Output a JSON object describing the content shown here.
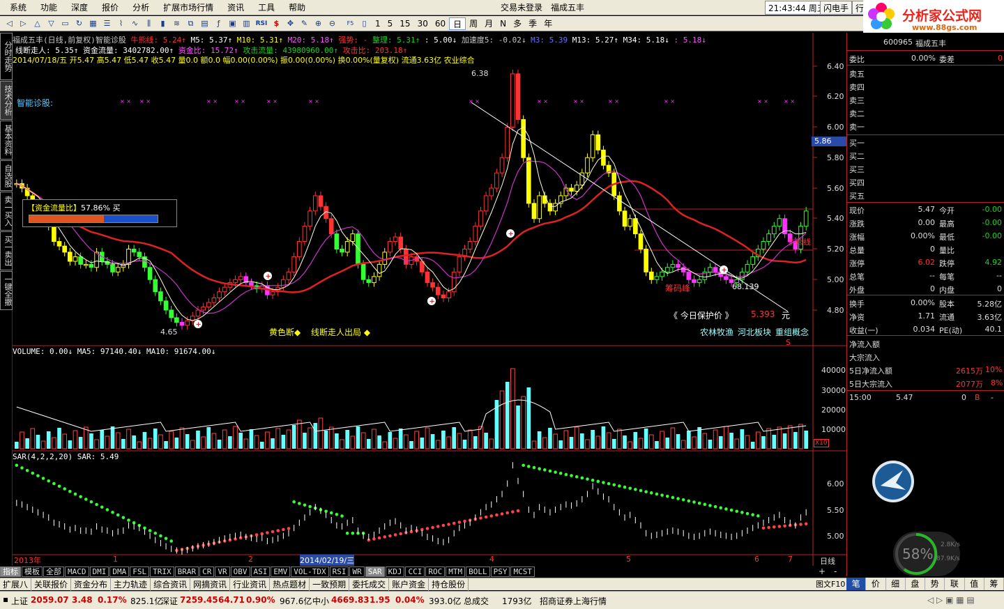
{
  "menu": {
    "items": [
      "系统",
      "功能",
      "深度",
      "报价",
      "分析",
      "扩展市场行情",
      "资讯",
      "工具",
      "帮助"
    ],
    "login_status": "交易未登录",
    "stock_name": "福成五丰",
    "clock": "21:43:44 周五",
    "btn1": "闪电手",
    "btn2": "行"
  },
  "toolbar": {
    "periods": [
      "1",
      "5",
      "15",
      "30",
      "60",
      "日",
      "周",
      "月",
      "N",
      "多",
      "季",
      "年"
    ],
    "active_period": "日",
    "rsi": "RSI"
  },
  "logo": {
    "title": "分析家公式网",
    "url": "www.88gs.com"
  },
  "left_tabs": [
    "分时走势",
    "技术分析",
    "基本资料",
    "自选股",
    "卖一买入",
    "买一卖出",
    "一键全撤"
  ],
  "chart": {
    "header1": {
      "name": "福成五丰(日线,前复权)智能诊股",
      "niu_label": "牛熊线: 5.24↑",
      "ma5": "M5: 5.37↑",
      "ma10": "M10: 5.31↑",
      "ma20": "M20: 5.18↑",
      "qiangshi": "强势: -",
      "zhengli": "整理: 5.31↑",
      "v1": ": 5.00↓",
      "accel": "加速度5: -0.02↓",
      "m3": "M3: 5.39",
      "m13": "M13: 5.27↑",
      "m34": "M34: 5.18↓",
      "v2": ": 5.18↓"
    },
    "header2": {
      "xdzr": "线断走人: 5.35↑",
      "zjll": "资金流量: 3402782.00↑",
      "zjb": "资金比: 15.72↑",
      "gjll": "攻击流量: 43980960.00↑",
      "gjb": "攻击比: 203.18↑"
    },
    "header3": "2014/07/18/五 开5.47 高5.47 低5.47 收5.47 量0.0 额0.0 幅0.00(0.00%) 振0.00(0.00%) 换0.00%(量复权) 流通3.63亿 农业综合",
    "zhineng": "智能诊股:",
    "fund_box": {
      "label": "【资金流量比】",
      "value": "57.86%",
      "suffix": "买",
      "buy_ratio": 0.58
    },
    "ann": {
      "high": "6.38",
      "low": "4.65",
      "niu": "牛熊线",
      "chouma": "筹码峰",
      "v68": "68.139",
      "protect_label": "《 今日保护价 》",
      "protect_val": "5.393",
      "yuan": "元",
      "huangse": "黄色断",
      "xduan": "线断走人出局",
      "tag1": "农林牧渔",
      "tag2": "河北板块",
      "tag3": "重组概念",
      "s": "S"
    },
    "price_axis": [
      "6.40",
      "6.20",
      "6.00",
      "5.80",
      "5.60",
      "5.40",
      "5.20",
      "5.00",
      "4.80"
    ],
    "current_price": "5.86",
    "volume_header": "VOLUME: 0.00↓ MA5: 97140.40↓ MA10: 91674.00↓",
    "volume_axis": [
      "40000",
      "30000",
      "20000",
      "10000"
    ],
    "vol_unit": "X10",
    "sar_header": "SAR(4,2,2,20) SAR: 5.49",
    "sar_axis": [
      "6.00",
      "5.50",
      "5.00"
    ],
    "date_axis": [
      {
        "t": "2013年"
      },
      {
        "t": "1"
      },
      {
        "t": "2"
      },
      {
        "t": "2014/02/19/三"
      },
      {
        "t": "4"
      },
      {
        "t": "5"
      },
      {
        "t": "6"
      },
      {
        "t": "7"
      }
    ],
    "period_label": "日线"
  },
  "bottom_tabs": [
    "指标",
    "模板",
    "全部",
    "MACD",
    "DMI",
    "DMA",
    "FSL",
    "TRIX",
    "BRAR",
    "CR",
    "VR",
    "OBV",
    "ASI",
    "EMV",
    "VOL-TDX",
    "RSI",
    "WR",
    "SAR",
    "KDJ",
    "CCI",
    "ROC",
    "MTM",
    "BOLL",
    "PSY",
    "MCST"
  ],
  "bottom_active": "指标",
  "bottom_right": {
    "plus": "+",
    "minus": "-"
  },
  "nav_tabs": [
    "扩展八",
    "关联报价",
    "资金分布",
    "主力轨迹",
    "综合资讯",
    "网摘资讯",
    "行业资讯",
    "热点题材",
    "一致预期",
    "委托成交",
    "账户资金",
    "持仓股份"
  ],
  "chart_label": "图文F10",
  "right_tabs": [
    "笔",
    "价",
    "细",
    "盘",
    "势",
    "联",
    "值",
    "筹"
  ],
  "right_active": "笔",
  "quote": {
    "code": "600965",
    "name": "福成五丰",
    "weibi_l": "委比",
    "weibi_v": "0.00%",
    "weicha_l": "委差",
    "weicha_v": "0",
    "sell": [
      "卖五",
      "卖四",
      "卖三",
      "卖二",
      "卖一"
    ],
    "buy": [
      "买一",
      "买二",
      "买三",
      "买四",
      "买五"
    ],
    "rows": [
      {
        "l1": "现价",
        "v1": "5.47",
        "l2": "今开",
        "v2": "-0.00"
      },
      {
        "l1": "涨跌",
        "v1": "0.00",
        "l2": "最高",
        "v2": "-0.00"
      },
      {
        "l1": "涨幅",
        "v1": "0.00%",
        "l2": "最低",
        "v2": "-0.00"
      },
      {
        "l1": "总量",
        "v1": "0",
        "l2": "量比",
        "v2": ""
      },
      {
        "l1": "涨停",
        "v1": "6.02",
        "l2": "跌停",
        "v2": "4.92"
      },
      {
        "l1": "总笔",
        "v1": "--",
        "l2": "每笔",
        "v2": "--"
      },
      {
        "l1": "外盘",
        "v1": "0",
        "l2": "内盘",
        "v2": "0"
      }
    ],
    "rows2": [
      {
        "l1": "换手",
        "v1": "0.00%",
        "l2": "股本",
        "v2": "5.28亿"
      },
      {
        "l1": "净资",
        "v1": "1.71",
        "l2": "流通",
        "v2": "3.63亿"
      },
      {
        "l1": "收益(一)",
        "v1": "0.034",
        "l2": "PE(动)",
        "v2": "40.1"
      }
    ],
    "flow": [
      "净流入额",
      "大宗流入"
    ],
    "flow5": [
      {
        "l": "5日净流入额",
        "v": "2615万",
        "p": "10%"
      },
      {
        "l": "5日大宗流入",
        "v": "2077万",
        "p": "8%"
      }
    ],
    "tick": {
      "time": "15:00",
      "price": "5.47",
      "vol": "0",
      "bs": "B",
      "x": "-"
    },
    "gauge": {
      "pct": "58%",
      "up": "2.8K/s",
      "down": "87.9K/s"
    }
  },
  "status": {
    "sh_l": "上证",
    "sh_v": "2059.07",
    "sh_c": "3.48",
    "sh_p": "0.17%",
    "sh_a": "825.1亿",
    "sz_l": "深证",
    "sz_v": "7259.45",
    "sz_c": "64.71",
    "sz_p": "0.90%",
    "sz_a": "967.6亿",
    "zx_l": "中小",
    "zx_v": "4669.83",
    "zx_c": "1.95",
    "zx_p": "0.04%",
    "zx_a": "393.0亿",
    "total_l": "总成交",
    "total_v": "1793亿",
    "broker": "招商证券上海行情"
  }
}
